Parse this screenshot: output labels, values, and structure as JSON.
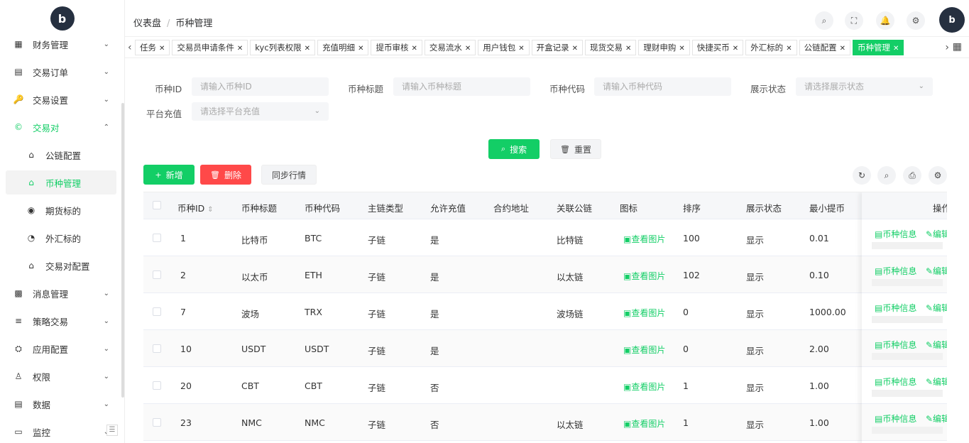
{
  "sidebar": {
    "logo": "b",
    "items": [
      {
        "icon": "▦",
        "label": "财务管理",
        "chevron": "⌄"
      },
      {
        "icon": "▤",
        "label": "交易订单",
        "chevron": "⌄"
      },
      {
        "icon": "🔑",
        "label": "交易设置",
        "chevron": "⌄"
      },
      {
        "icon": "©",
        "label": "交易对",
        "chevron": "⌃"
      },
      {
        "icon": "⌂",
        "label": "公链配置"
      },
      {
        "icon": "⌂",
        "label": "币种管理"
      },
      {
        "icon": "◉",
        "label": "期货标的"
      },
      {
        "icon": "◔",
        "label": "外汇标的"
      },
      {
        "icon": "⌂",
        "label": "交易对配置"
      },
      {
        "icon": "▩",
        "label": "消息管理",
        "chevron": "⌄"
      },
      {
        "icon": "≡",
        "label": "策略交易",
        "chevron": "⌄"
      },
      {
        "icon": "⛭",
        "label": "应用配置",
        "chevron": "⌄"
      },
      {
        "icon": "♙",
        "label": "权限",
        "chevron": "⌄"
      },
      {
        "icon": "▤",
        "label": "数据",
        "chevron": "⌄"
      },
      {
        "icon": "▭",
        "label": "监控",
        "chevron": "⌄"
      }
    ],
    "collapse_icon": "☰"
  },
  "header": {
    "breadcrumb": [
      "仪表盘",
      "币种管理"
    ],
    "breadcrumb_sep": "/",
    "icons": {
      "search": "⌕",
      "fullscreen": "⛶",
      "bell": "🔔",
      "settings": "⚙"
    },
    "avatar": "b"
  },
  "tags": {
    "left_arrow": "‹",
    "right_arrow": "›",
    "grid": "▦",
    "close": "✕",
    "items": [
      "任务",
      "交易员申请条件",
      "kyc列表权限",
      "充值明细",
      "提币审核",
      "交易流水",
      "用户钱包",
      "开盒记录",
      "现货交易",
      "理财申购",
      "快捷买币",
      "外汇标的",
      "公链配置",
      "币种管理"
    ],
    "active_index": 13
  },
  "filters": {
    "coin_id": {
      "label": "币种ID",
      "placeholder": "请输入币种ID"
    },
    "coin_title": {
      "label": "币种标题",
      "placeholder": "请输入币种标题"
    },
    "coin_code": {
      "label": "币种代码",
      "placeholder": "请输入币种代码"
    },
    "display_status": {
      "label": "展示状态",
      "placeholder": "请选择展示状态"
    },
    "platform_recharge": {
      "label": "平台充值",
      "placeholder": "请选择平台充值"
    },
    "dropdown_icon": "⌄"
  },
  "actions": {
    "search": "搜索",
    "search_icon": "⌕",
    "reset": "重置",
    "reset_icon": "🗑",
    "add": "新增",
    "add_icon": "+",
    "delete": "删除",
    "delete_icon": "🗑",
    "sync": "同步行情",
    "tool_icons": {
      "refresh": "↻",
      "search": "⌕",
      "print": "⎙",
      "settings": "⚙"
    }
  },
  "table": {
    "columns": [
      "币种ID",
      "币种标题",
      "币种代码",
      "主链类型",
      "允许充值",
      "合约地址",
      "关联公链",
      "图标",
      "排序",
      "展示状态",
      "最小提币",
      "操作"
    ],
    "sort_icon": "⇕",
    "view_image": "▣查看图片",
    "op_info": "▤币种信息",
    "op_edit": "✎编辑",
    "rows": [
      {
        "id": "1",
        "title": "比特币",
        "code": "BTC",
        "chain_type": "子链",
        "allow": "是",
        "contract": "",
        "public_chain": "比特链",
        "sort": "100",
        "status": "显示",
        "min": "0.01"
      },
      {
        "id": "2",
        "title": "以太币",
        "code": "ETH",
        "chain_type": "子链",
        "allow": "是",
        "contract": "",
        "public_chain": "以太链",
        "sort": "102",
        "status": "显示",
        "min": "0.10"
      },
      {
        "id": "7",
        "title": "波场",
        "code": "TRX",
        "chain_type": "子链",
        "allow": "是",
        "contract": "",
        "public_chain": "波场链",
        "sort": "0",
        "status": "显示",
        "min": "1000.00"
      },
      {
        "id": "10",
        "title": "USDT",
        "code": "USDT",
        "chain_type": "子链",
        "allow": "是",
        "contract": "",
        "public_chain": "",
        "sort": "0",
        "status": "显示",
        "min": "2.00"
      },
      {
        "id": "20",
        "title": "CBT",
        "code": "CBT",
        "chain_type": "子链",
        "allow": "否",
        "contract": "",
        "public_chain": "",
        "sort": "1",
        "status": "显示",
        "min": "1.00"
      },
      {
        "id": "23",
        "title": "NMC",
        "code": "NMC",
        "chain_type": "子链",
        "allow": "否",
        "contract": "",
        "public_chain": "以太链",
        "sort": "1",
        "status": "显示",
        "min": "1.00"
      }
    ]
  },
  "colors": {
    "accent": "#13ce66",
    "danger": "#ff4949"
  }
}
